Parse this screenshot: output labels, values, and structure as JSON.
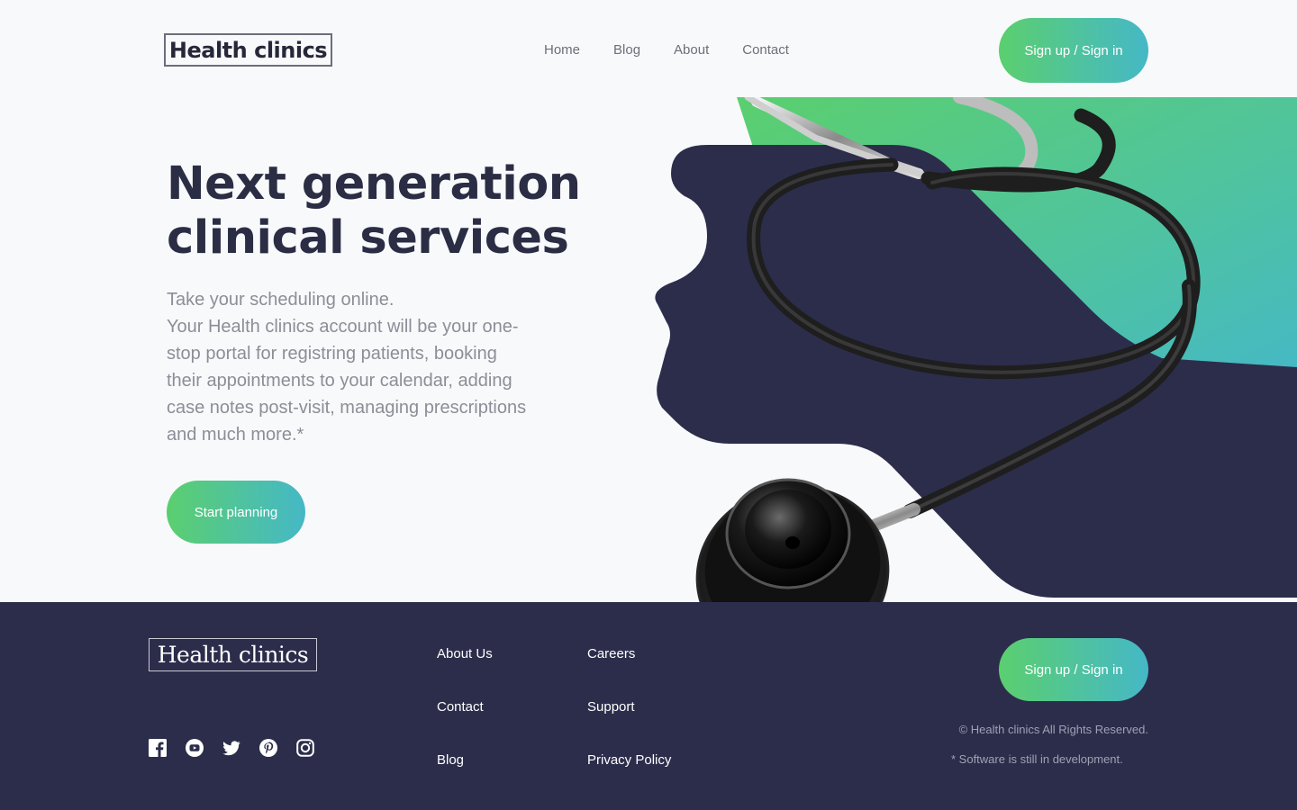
{
  "header": {
    "logo": "Health clinics",
    "nav": [
      "Home",
      "Blog",
      "About",
      "Contact"
    ],
    "cta": "Sign up / Sign in"
  },
  "hero": {
    "title_lines": [
      "Next generation",
      "clinical services"
    ],
    "body_lines": [
      "Take your scheduling online.",
      "Your Health clinics account will be your one-",
      "stop portal for registring patients, booking",
      "their appointments to your calendar, adding",
      "case notes post-visit, managing prescriptions",
      "and much more.*"
    ],
    "cta": "Start planning"
  },
  "footer": {
    "logo": "Health clinics",
    "links_col1": [
      "About Us",
      "Contact",
      "Blog"
    ],
    "links_col2": [
      "Careers",
      "Support",
      "Privacy Policy"
    ],
    "cta": "Sign up / Sign in",
    "copyright": "© Health clinics All Rights Reserved.",
    "note": "* Software is still in development.",
    "social_icons": [
      "facebook-icon",
      "youtube-icon",
      "twitter-icon",
      "pinterest-icon",
      "instagram-icon"
    ]
  },
  "colors": {
    "navy": "#2c2d4b",
    "gradient_start": "#5bcf6e",
    "gradient_end": "#45b8c6"
  }
}
